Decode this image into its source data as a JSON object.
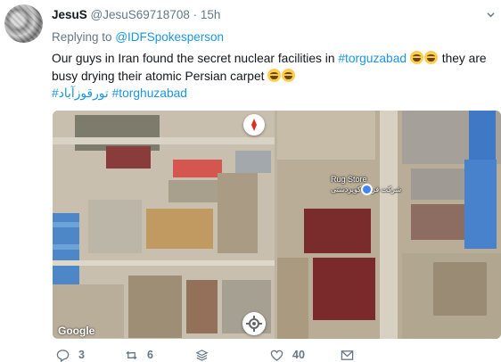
{
  "tweet": {
    "author_name": "JesuS",
    "author_handle": "@JesuS69718708",
    "separator": "·",
    "time": "15h",
    "reply_prefix": "Replying to",
    "reply_to": "@IDFSpokesperson",
    "text_part1": "Our guys in Iran found the secret nuclear facilities in",
    "hashtag1": "#torguzabad",
    "text_part2": "they are busy drying their atomic Persian carpet",
    "hashtag_fa": "#تورقوزآباد",
    "hashtag2": "#torghuzabad"
  },
  "media": {
    "google_label": "Google",
    "rug_store_label": "Rug Store",
    "rug_store_label_fa": "شرکت فرش کوپردشتی"
  },
  "actions": {
    "replies": "3",
    "retweets": "6",
    "likes": "40"
  },
  "icons": {
    "reply": "reply-icon",
    "retweet": "retweet-icon",
    "stack": "stack-icon",
    "like": "heart-icon",
    "dm": "envelope-icon",
    "caret": "chevron-down-icon",
    "emoji": "laughing-emoji-icon"
  },
  "colors": {
    "link": "#1b95e0",
    "muted": "#657786",
    "text": "#14171a"
  }
}
